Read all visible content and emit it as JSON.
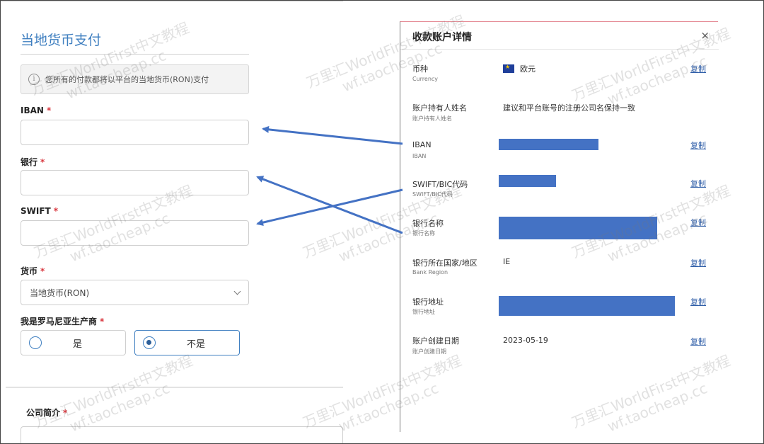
{
  "form": {
    "title": "当地货币支付",
    "notice": "您所有的付款都将以平台的当地货币(RON)支付",
    "fields": {
      "iban": {
        "label": "IBAN",
        "required": "*"
      },
      "bank": {
        "label": "银行",
        "required": "*"
      },
      "swift": {
        "label": "SWIFT",
        "required": "*"
      },
      "currency": {
        "label": "货币",
        "required": "*",
        "selected": "当地货币(RON)"
      },
      "producer": {
        "label": "我是罗马尼亚生产商",
        "required": "*",
        "options": [
          "是",
          "不是"
        ],
        "selected": "不是"
      }
    },
    "section2": {
      "label": "公司简介",
      "required": "*"
    }
  },
  "panel": {
    "title": "收款账户详情",
    "close": "×",
    "copy_label": "复制",
    "rows": {
      "currency": {
        "label": "币种",
        "sub": "Currency",
        "value": "欧元"
      },
      "holder": {
        "label": "账户持有人姓名",
        "sub": "账户持有人姓名",
        "value": "建议和平台账号的注册公司名保持一致"
      },
      "iban": {
        "label": "IBAN",
        "sub": "IBAN"
      },
      "swift": {
        "label": "SWIFT/BIC代码",
        "sub": "SWIFT/BIC代码"
      },
      "bank_name": {
        "label": "银行名称",
        "sub": "银行名称"
      },
      "region": {
        "label": "银行所在国家/地区",
        "sub": "Bank Region",
        "value": "IE"
      },
      "address": {
        "label": "银行地址",
        "sub": "银行地址"
      },
      "created": {
        "label": "账户创建日期",
        "sub": "账户创建日期",
        "value": "2023-05-19"
      }
    }
  },
  "watermark": {
    "line1": "万里汇WorldFirst中文教程",
    "line2": "wf.taocheap.cc"
  },
  "colors": {
    "accent": "#3f7fc0",
    "required": "#d9363e",
    "link": "#2f5ea8",
    "redaction": "#4472c4",
    "arrow": "#4472c4"
  }
}
